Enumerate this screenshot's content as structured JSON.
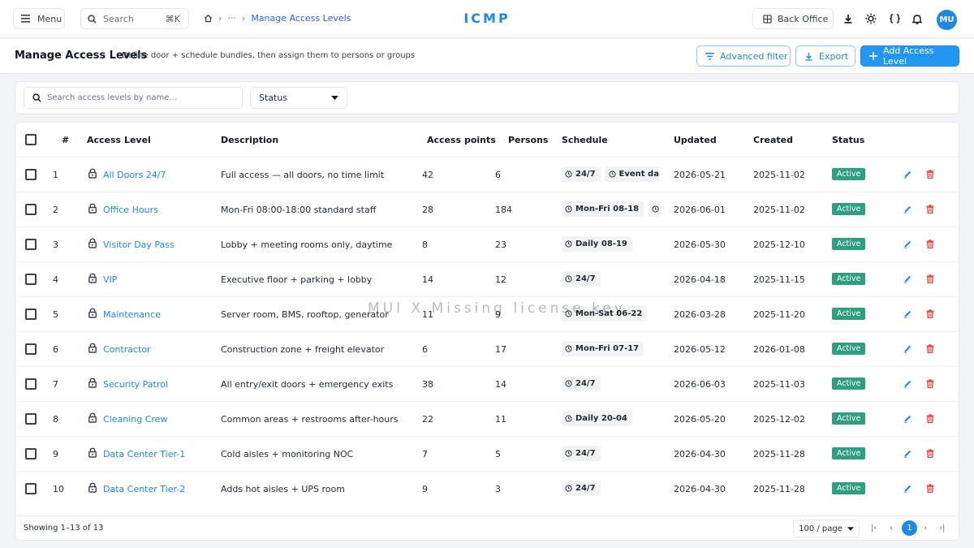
{
  "topbar": {
    "menu_label": "Menu",
    "search_label": "Search",
    "search_shortcut": "⌘K",
    "breadcrumb_ellipsis": "···",
    "breadcrumb_current": "Manage Access Levels",
    "brand": "ICMP",
    "back_office_label": "Back Office",
    "avatar_initials": "MU"
  },
  "header": {
    "title": "Manage Access Levels",
    "subtitle": "Define door + schedule bundles, then assign them to persons or groups",
    "advanced_filter_label": "Advanced filter",
    "export_label": "Export",
    "add_label": "Add Access Level"
  },
  "filters": {
    "search_placeholder": "Search access levels by name...",
    "status_label": "Status"
  },
  "table": {
    "columns": {
      "index": "#",
      "name": "Access Level",
      "description": "Description",
      "access_points": "Access points",
      "persons": "Persons",
      "schedule": "Schedule",
      "updated": "Updated",
      "created": "Created",
      "status": "Status"
    },
    "rows": [
      {
        "index": "1",
        "name": "All Doors 24/7",
        "description": "Full access — all doors, no time limit",
        "access_points": "42",
        "persons": "6",
        "schedule": [
          "24/7",
          "Event date"
        ],
        "updated": "2026-05-21",
        "created": "2025-11-02",
        "status": "Active"
      },
      {
        "index": "2",
        "name": "Office Hours",
        "description": "Mon-Fri 08:00-18:00 standard staff",
        "access_points": "28",
        "persons": "184",
        "schedule": [
          "Mon-Fri 08-18",
          "Mo"
        ],
        "updated": "2026-06-01",
        "created": "2025-11-02",
        "status": "Active"
      },
      {
        "index": "3",
        "name": "Visitor Day Pass",
        "description": "Lobby + meeting rooms only, daytime",
        "access_points": "8",
        "persons": "23",
        "schedule": [
          "Daily 08-19"
        ],
        "updated": "2026-05-30",
        "created": "2025-12-10",
        "status": "Active"
      },
      {
        "index": "4",
        "name": "VIP",
        "description": "Executive floor + parking + lobby",
        "access_points": "14",
        "persons": "12",
        "schedule": [
          "24/7"
        ],
        "updated": "2026-04-18",
        "created": "2025-11-15",
        "status": "Active"
      },
      {
        "index": "5",
        "name": "Maintenance",
        "description": "Server room, BMS, rooftop, generator",
        "access_points": "11",
        "persons": "9",
        "schedule": [
          "Mon-Sat 06-22"
        ],
        "updated": "2026-03-28",
        "created": "2025-11-20",
        "status": "Active"
      },
      {
        "index": "6",
        "name": "Contractor",
        "description": "Construction zone + freight elevator",
        "access_points": "6",
        "persons": "17",
        "schedule": [
          "Mon-Fri 07-17"
        ],
        "updated": "2026-05-12",
        "created": "2026-01-08",
        "status": "Active"
      },
      {
        "index": "7",
        "name": "Security Patrol",
        "description": "All entry/exit doors + emergency exits",
        "access_points": "38",
        "persons": "14",
        "schedule": [
          "24/7"
        ],
        "updated": "2026-06-03",
        "created": "2025-11-03",
        "status": "Active"
      },
      {
        "index": "8",
        "name": "Cleaning Crew",
        "description": "Common areas + restrooms after-hours",
        "access_points": "22",
        "persons": "11",
        "schedule": [
          "Daily 20-04"
        ],
        "updated": "2026-05-20",
        "created": "2025-12-02",
        "status": "Active"
      },
      {
        "index": "9",
        "name": "Data Center Tier-1",
        "description": "Cold aisles + monitoring NOC",
        "access_points": "7",
        "persons": "5",
        "schedule": [
          "24/7"
        ],
        "updated": "2026-04-30",
        "created": "2025-11-28",
        "status": "Active"
      },
      {
        "index": "10",
        "name": "Data Center Tier-2",
        "description": "Adds hot aisles + UPS room",
        "access_points": "9",
        "persons": "3",
        "schedule": [
          "24/7"
        ],
        "updated": "2026-04-30",
        "created": "2025-11-28",
        "status": "Active"
      }
    ]
  },
  "footer": {
    "showing": "Showing 1–13 of 13",
    "page_size": "100 / page",
    "current_page": "1"
  },
  "watermark": "MUI X Missing license key",
  "colors": {
    "accent": "#1e88e5",
    "status_active": "#2e9f7f",
    "delete": "#e53935"
  }
}
